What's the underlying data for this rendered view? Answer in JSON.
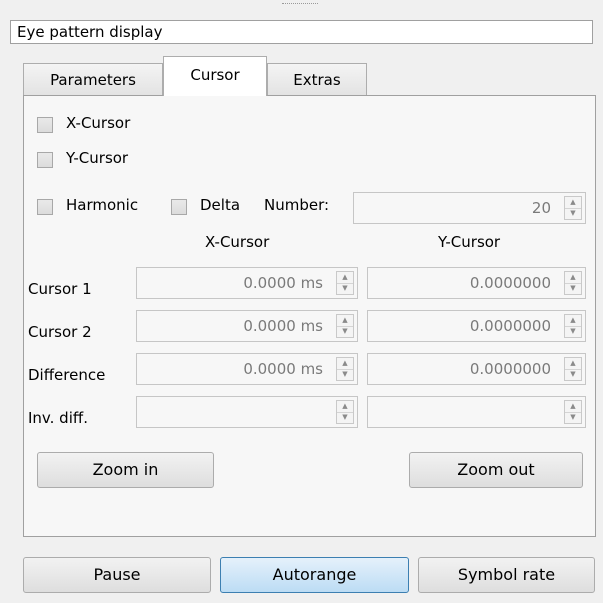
{
  "window": {
    "title": "Eye pattern display"
  },
  "tabs": [
    {
      "label": "Parameters"
    },
    {
      "label": "Cursor"
    },
    {
      "label": "Extras"
    }
  ],
  "active_tab": "Cursor",
  "cursor_tab": {
    "x_cursor_checkbox": {
      "label": "X-Cursor",
      "checked": false
    },
    "y_cursor_checkbox": {
      "label": "Y-Cursor",
      "checked": false
    },
    "harmonic_checkbox": {
      "label": "Harmonic",
      "checked": false
    },
    "delta_checkbox": {
      "label": "Delta",
      "checked": false
    },
    "number": {
      "label": "Number:",
      "value": "20"
    },
    "columns": {
      "x": "X-Cursor",
      "y": "Y-Cursor"
    },
    "rows": [
      {
        "label": "Cursor 1",
        "x": "0.0000 ms",
        "y": "0.0000000"
      },
      {
        "label": "Cursor 2",
        "x": "0.0000 ms",
        "y": "0.0000000"
      },
      {
        "label": "Difference",
        "x": "0.0000 ms",
        "y": "0.0000000"
      },
      {
        "label": "Inv. diff.",
        "x": "",
        "y": ""
      }
    ],
    "zoom_in": "Zoom in",
    "zoom_out": "Zoom out"
  },
  "bottom_buttons": {
    "pause": "Pause",
    "autorange": "Autorange",
    "symbol_rate": "Symbol rate"
  },
  "icons": {
    "spin_up": "▲",
    "spin_down": "▼"
  }
}
